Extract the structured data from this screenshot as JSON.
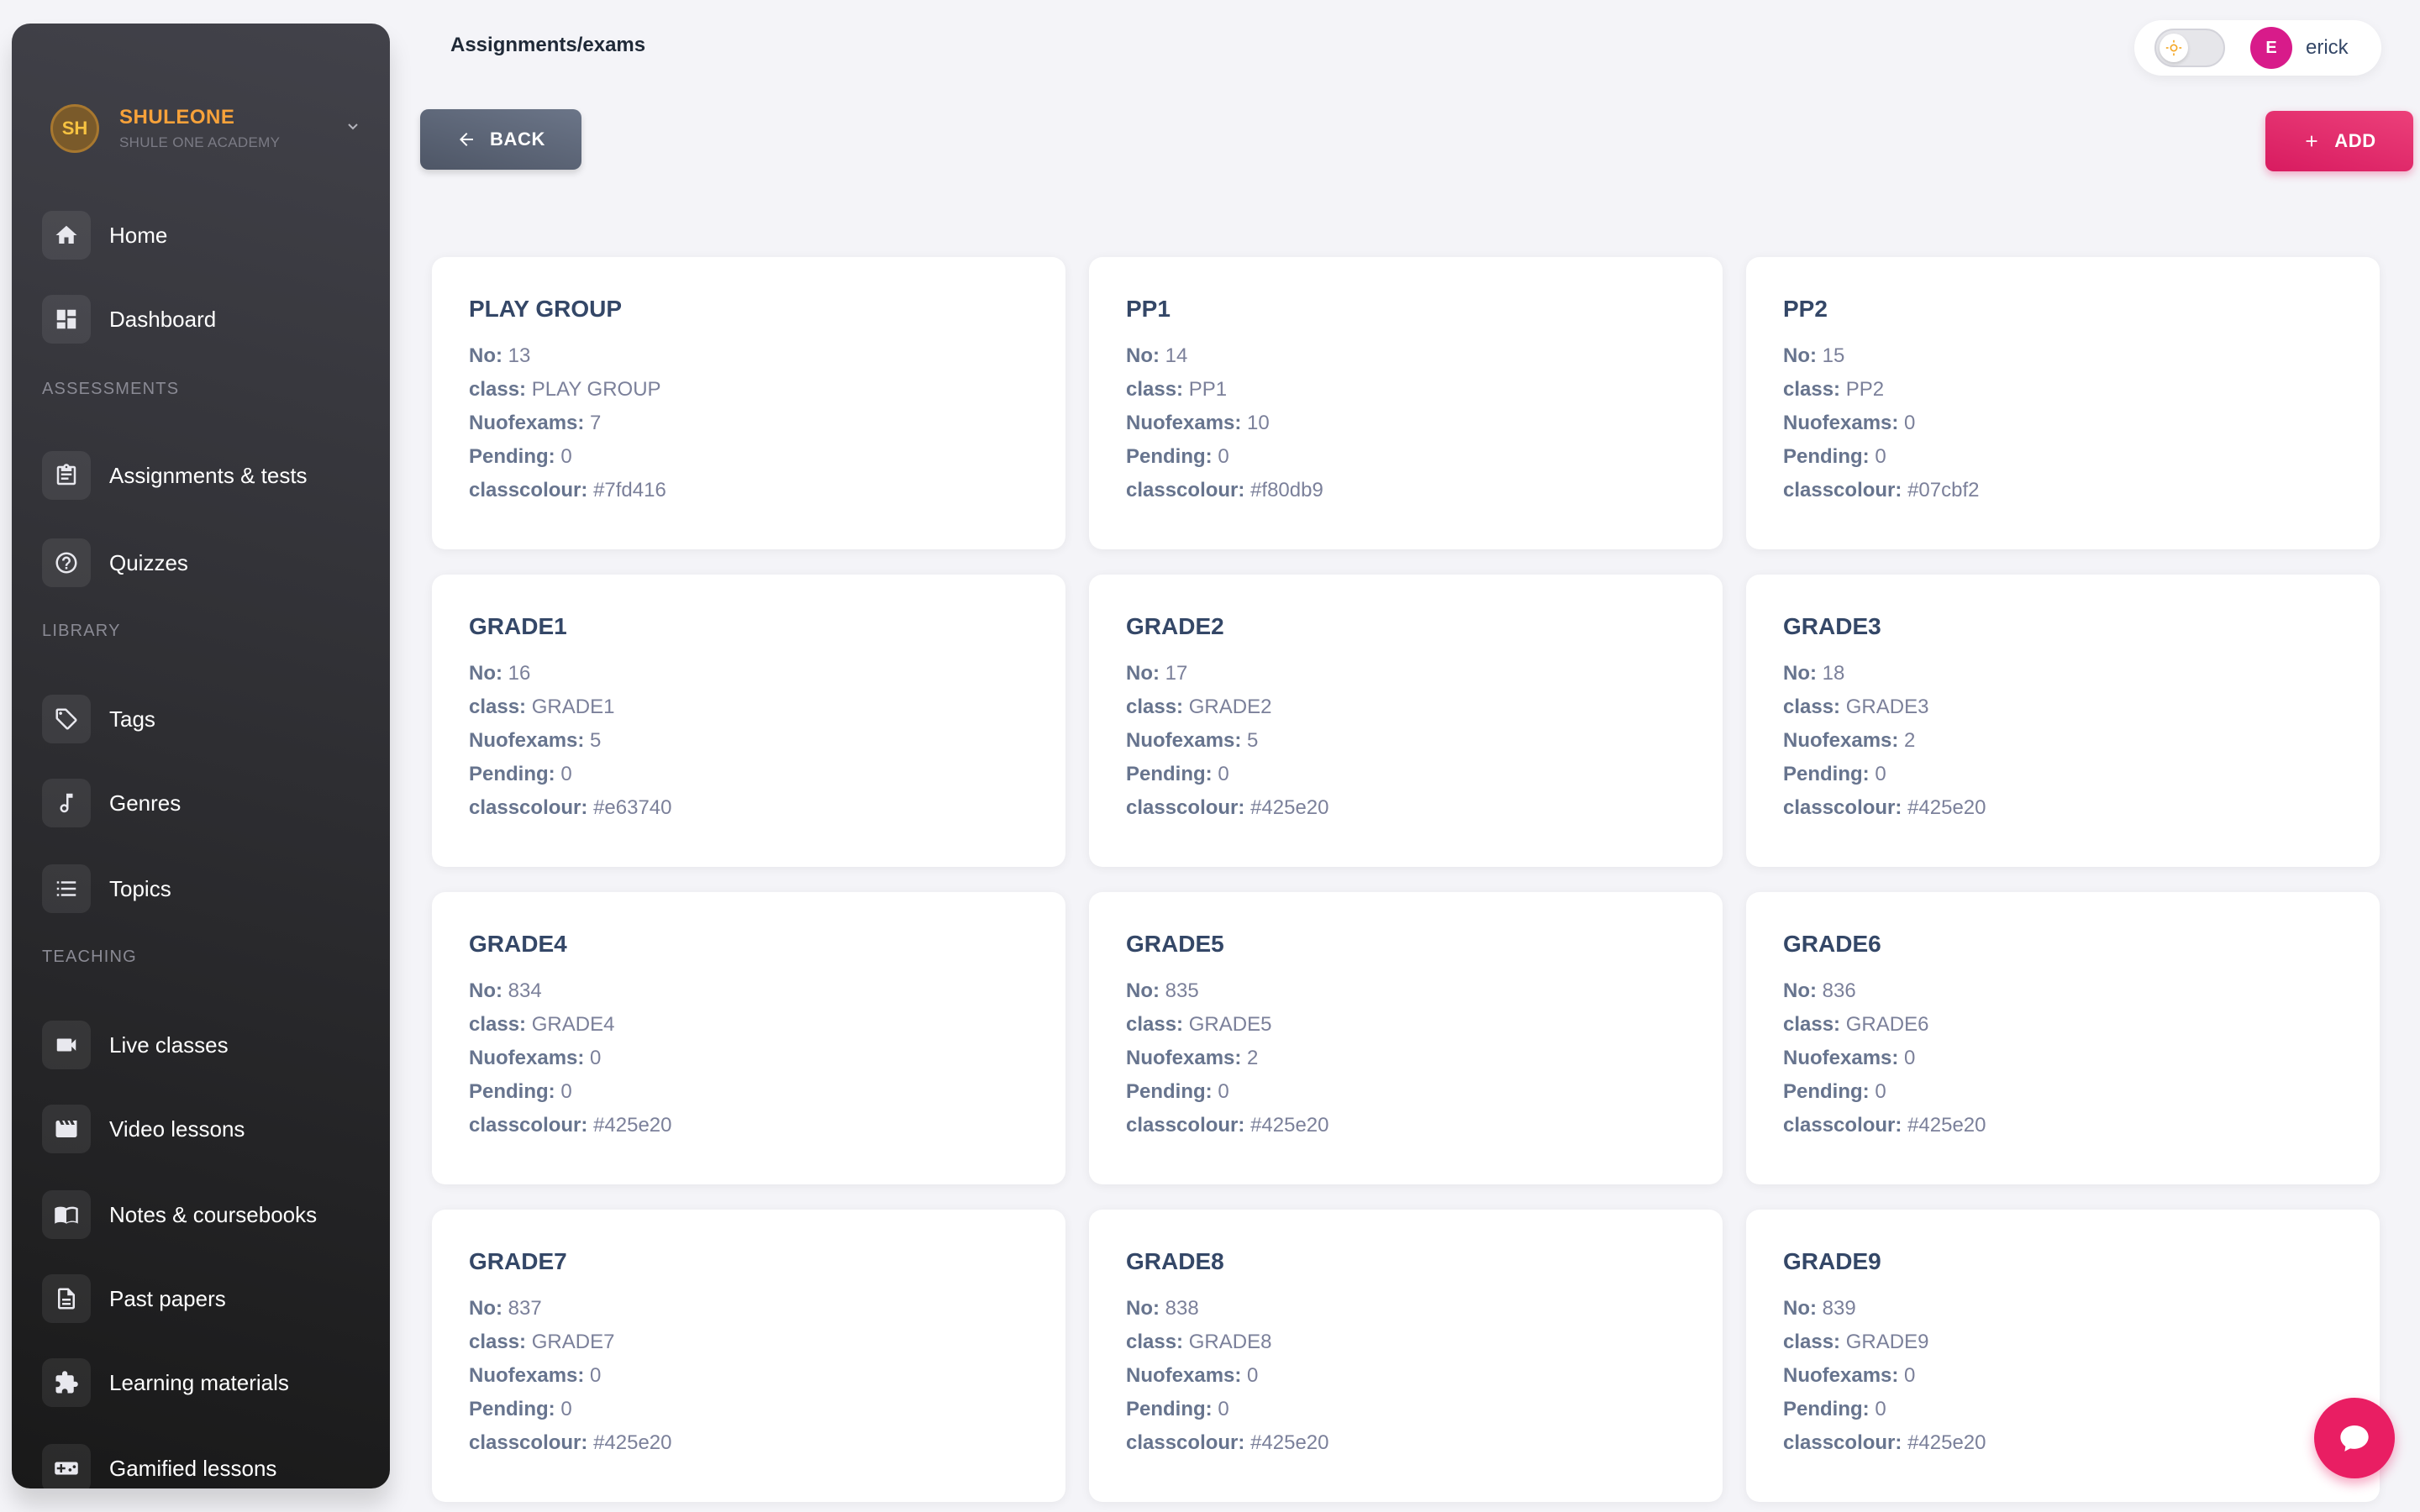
{
  "brand": {
    "initials": "SH",
    "name": "SHULEONE",
    "subtitle": "SHULE ONE ACADEMY"
  },
  "sidebar": {
    "items": [
      {
        "label": "Home",
        "icon": "home-icon"
      },
      {
        "label": "Dashboard",
        "icon": "dashboard-icon"
      },
      {
        "label": "Assignments & tests",
        "icon": "clipboard-icon"
      },
      {
        "label": "Quizzes",
        "icon": "question-icon"
      },
      {
        "label": "Tags",
        "icon": "tag-icon"
      },
      {
        "label": "Genres",
        "icon": "music-note-icon"
      },
      {
        "label": "Topics",
        "icon": "list-icon"
      },
      {
        "label": "Live classes",
        "icon": "video-camera-icon"
      },
      {
        "label": "Video lessons",
        "icon": "clapperboard-icon"
      },
      {
        "label": "Notes & coursebooks",
        "icon": "book-icon"
      },
      {
        "label": "Past papers",
        "icon": "document-icon"
      },
      {
        "label": "Learning materials",
        "icon": "puzzle-icon"
      },
      {
        "label": "Gamified lessons",
        "icon": "gamepad-icon"
      }
    ],
    "sections": {
      "assessments": "ASSESSMENTS",
      "library": "LIBRARY",
      "teaching": "TEACHING"
    }
  },
  "header": {
    "breadcrumb": "Assignments/exams",
    "user_initial": "E",
    "user_name": "erick"
  },
  "actions": {
    "back_label": "BACK",
    "add_label": "ADD"
  },
  "field_labels": {
    "no": "No:",
    "class": "class:",
    "nuofexams": "Nuofexams:",
    "pending": "Pending:",
    "classcolour": "classcolour:"
  },
  "cards": [
    {
      "title": "PLAY GROUP",
      "no": "13",
      "class": "PLAY GROUP",
      "nuofexams": "7",
      "pending": "0",
      "classcolour": "#7fd416"
    },
    {
      "title": "PP1",
      "no": "14",
      "class": "PP1",
      "nuofexams": "10",
      "pending": "0",
      "classcolour": "#f80db9"
    },
    {
      "title": "PP2",
      "no": "15",
      "class": "PP2",
      "nuofexams": "0",
      "pending": "0",
      "classcolour": "#07cbf2"
    },
    {
      "title": "GRADE1",
      "no": "16",
      "class": "GRADE1",
      "nuofexams": "5",
      "pending": "0",
      "classcolour": "#e63740"
    },
    {
      "title": "GRADE2",
      "no": "17",
      "class": "GRADE2",
      "nuofexams": "5",
      "pending": "0",
      "classcolour": "#425e20"
    },
    {
      "title": "GRADE3",
      "no": "18",
      "class": "GRADE3",
      "nuofexams": "2",
      "pending": "0",
      "classcolour": "#425e20"
    },
    {
      "title": "GRADE4",
      "no": "834",
      "class": "GRADE4",
      "nuofexams": "0",
      "pending": "0",
      "classcolour": "#425e20"
    },
    {
      "title": "GRADE5",
      "no": "835",
      "class": "GRADE5",
      "nuofexams": "2",
      "pending": "0",
      "classcolour": "#425e20"
    },
    {
      "title": "GRADE6",
      "no": "836",
      "class": "GRADE6",
      "nuofexams": "0",
      "pending": "0",
      "classcolour": "#425e20"
    },
    {
      "title": "GRADE7",
      "no": "837",
      "class": "GRADE7",
      "nuofexams": "0",
      "pending": "0",
      "classcolour": "#425e20"
    },
    {
      "title": "GRADE8",
      "no": "838",
      "class": "GRADE8",
      "nuofexams": "0",
      "pending": "0",
      "classcolour": "#425e20"
    },
    {
      "title": "GRADE9",
      "no": "839",
      "class": "GRADE9",
      "nuofexams": "0",
      "pending": "0",
      "classcolour": "#425e20"
    }
  ],
  "colors": {
    "accent": "#e91e63",
    "brand_name": "#f7a23a",
    "sidebar_bg": "#191919"
  }
}
